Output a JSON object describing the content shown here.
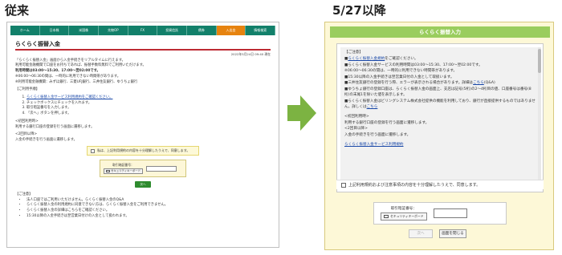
{
  "labels": {
    "before": "従来",
    "after": "5/27以降"
  },
  "old_screen": {
    "nav": [
      "ホーム",
      "日本株",
      "米国株",
      "先物OP",
      "FX",
      "投資信託",
      "債券",
      "入出金",
      "情報検索"
    ],
    "active_tab_index": 7,
    "title": "らくらく振替入金",
    "date": "2022年5月24日 09:40 現在",
    "intro": [
      "「らくらく振替入金」画面から入金手続きをリアルタイムに行えます。",
      "利用可能金融機関で口座をお持ちであれば、振替手数料無料でご利用いただけます。",
      "利用時間は03:00〜15:30、17:00〜翌02:00です。",
      "※06:00〜06:30の間は、一時的に利用できない時間帯があります。",
      "※利用可能金融機関：みずほ銀行、三菱UFJ銀行、三井住友銀行、ゆうちょ銀行"
    ],
    "howto_heading": "【ご利用手順】",
    "howto_steps": [
      "らくらく振替入金サービス利用規約をご確認ください。",
      "チェックボックスにチェックを入れます。",
      "取引暗証番号を入力します。",
      "「次へ」ボタンを押します。"
    ],
    "first_heading": "<初回利用時>",
    "first_text": "利用する銀行口座の登録を行う画面に遷移します。",
    "second_heading": "<2回目以降>",
    "second_text": "入金の手続きを行う画面に遷移します。",
    "agree_text": "私は、上記利用規約の内容を十分理解したうえで、同意します。",
    "pin_label": "取引暗証番号：",
    "keyboard_label": "セキュリティキーボード",
    "next_button": "次へ",
    "notes_heading": "【ご注意】",
    "notes": [
      "法人口座ではご利用いただけません。らくらく振替入金のQ&A",
      "らくらく振替入金の利用規約に同意できない方は、らくらく振替入金をご利用できません。",
      "らくらく振替入金の詳細はこちらをご確認ください。",
      "15:30以降の入金手続きは翌営業日付けの入金として扱われます。"
    ]
  },
  "new_screen": {
    "header": "らくらく振替入力",
    "notes_heading": "【ご注意】",
    "notes": [
      {
        "pre": "■",
        "link": "らくらく振替入金規約",
        "post": "をご確認ください。"
      },
      {
        "pre": "■らくらく振替入金サービスの利用時間は03:00〜15:30、17:00〜翌02:00です。",
        "link": "",
        "post": ""
      },
      {
        "pre": "※06:00〜06:30の間は、一時的に利用できない時間帯があります。",
        "link": "",
        "post": ""
      },
      {
        "pre": "■15:30以降の入金手続きは翌営業日付の入金として取扱います。",
        "link": "",
        "post": ""
      },
      {
        "pre": "■三井住友銀行の登録を行う際、エラーが表示される場合があります。詳細は",
        "link": "こちら",
        "post": "(Q&A)"
      },
      {
        "pre": "■ゆうちょ銀行の登録口座は、らくらく振替入金の画面上、支店は記号(5桁)の2〜4桁目の値、口座番号は番号(8桁)の末尾1を除いた値を表示します。",
        "link": "",
        "post": ""
      },
      {
        "pre": "■らくらく振替入金はビリングシステム株式会社提供の機能を利用しており、銀行が直接提供するものではありません。詳しくは",
        "link": "こちら",
        "post": ""
      }
    ],
    "first_heading": "<初回利用時>",
    "first_text": "利用する銀行口座の登録を行う画面に遷移します。",
    "second_heading": "<2回目以降>",
    "second_text": "入金の手続きを行う画面に遷移します。",
    "terms_link": "らくらく振替入金サービス利用規約",
    "agree_text": "上記利用規約および注意事項の内容を十分理解したうえで、同意します。",
    "pin_label": "取引暗証番号：",
    "keyboard_label": "セキュリティキーボード",
    "next_button": "次へ",
    "close_button": "画面を閉じる"
  },
  "colors": {
    "old_nav": "#12806a",
    "old_active_tab": "#e6830f",
    "old_title_bar": "#bd2b33",
    "new_header": "#9acd5e",
    "new_background": "#fdf8d7",
    "arrow": "#7cb342"
  },
  "icons": {
    "arrow": "right-arrow-icon",
    "keyboard": "keyboard-icon"
  }
}
